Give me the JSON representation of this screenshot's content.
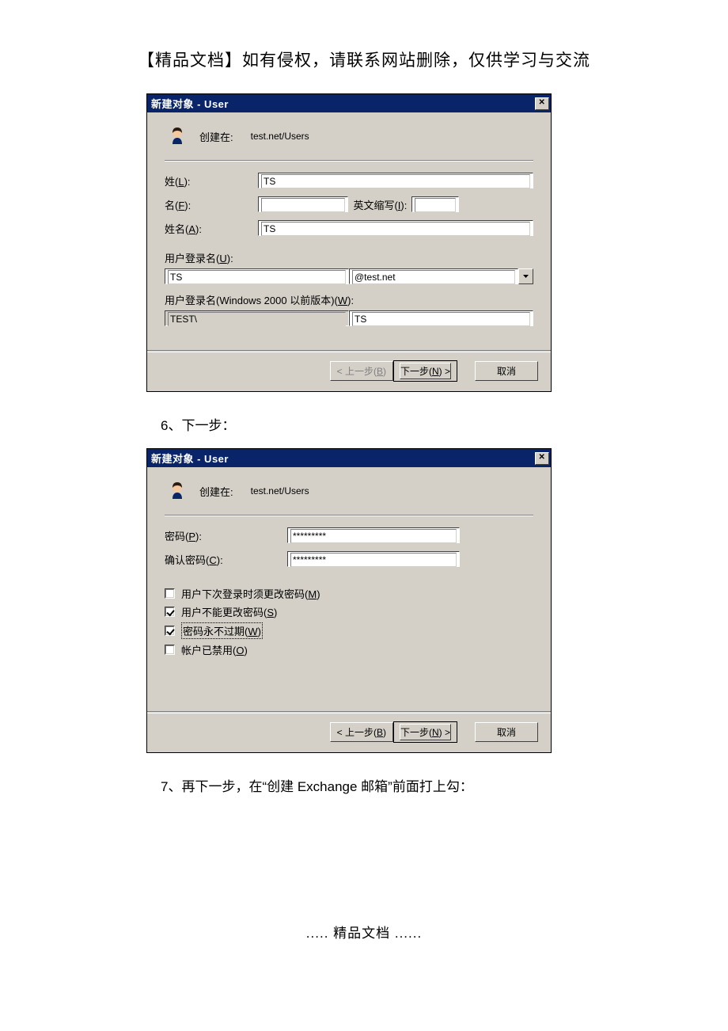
{
  "doc": {
    "header": "【精品文档】如有侵权，请联系网站删除，仅供学习与交流",
    "step6": "6、下一步：",
    "step7": "7、再下一步，在“创建 Exchange 邮箱”前面打上勾：",
    "footer": "..... 精品文档 ......"
  },
  "dialog1": {
    "title": "新建对象 - User",
    "create_in_label": "创建在:",
    "create_in_path": "test.net/Users",
    "surname_label_pre": "姓(",
    "surname_label_key": "L",
    "surname_label_post": "):",
    "surname_value": "TS",
    "given_label_pre": "名(",
    "given_label_key": "F",
    "given_label_post": "):",
    "given_value": "",
    "initials_label_pre": "英文缩写(",
    "initials_label_key": "I",
    "initials_label_post": "):",
    "initials_value": "",
    "fullname_label_pre": "姓名(",
    "fullname_label_key": "A",
    "fullname_label_post": "):",
    "fullname_value": "TS",
    "logon_label_pre": "用户登录名(",
    "logon_label_key": "U",
    "logon_label_post": "):",
    "logon_value": "TS",
    "logon_domain": "@test.net",
    "logon2000_label_pre": "用户登录名(Windows 2000 以前版本)(",
    "logon2000_label_key": "W",
    "logon2000_label_post": "):",
    "logon2000_domain": "TEST\\",
    "logon2000_value": "TS",
    "btn_back_pre": "< 上一步(",
    "btn_back_key": "B",
    "btn_back_post": ")",
    "btn_next_pre": "下一步(",
    "btn_next_key": "N",
    "btn_next_post": ") >",
    "btn_cancel": "取消"
  },
  "dialog2": {
    "title": "新建对象 - User",
    "create_in_label": "创建在:",
    "create_in_path": "test.net/Users",
    "pwd_label_pre": "密码(",
    "pwd_label_key": "P",
    "pwd_label_post": "):",
    "pwd_value": "*********",
    "confirm_label_pre": "确认密码(",
    "confirm_label_key": "C",
    "confirm_label_post": "):",
    "confirm_value": "*********",
    "chk1_pre": "用户下次登录时须更改密码(",
    "chk1_key": "M",
    "chk1_post": ")",
    "chk2_pre": "用户不能更改密码(",
    "chk2_key": "S",
    "chk2_post": ")",
    "chk3_pre": "密码永不过期(",
    "chk3_key": "W",
    "chk3_post": ")",
    "chk4_pre": "帐户已禁用(",
    "chk4_key": "O",
    "chk4_post": ")",
    "btn_back_pre": "< 上一步(",
    "btn_back_key": "B",
    "btn_back_post": ")",
    "btn_next_pre": "下一步(",
    "btn_next_key": "N",
    "btn_next_post": ") >",
    "btn_cancel": "取消"
  }
}
